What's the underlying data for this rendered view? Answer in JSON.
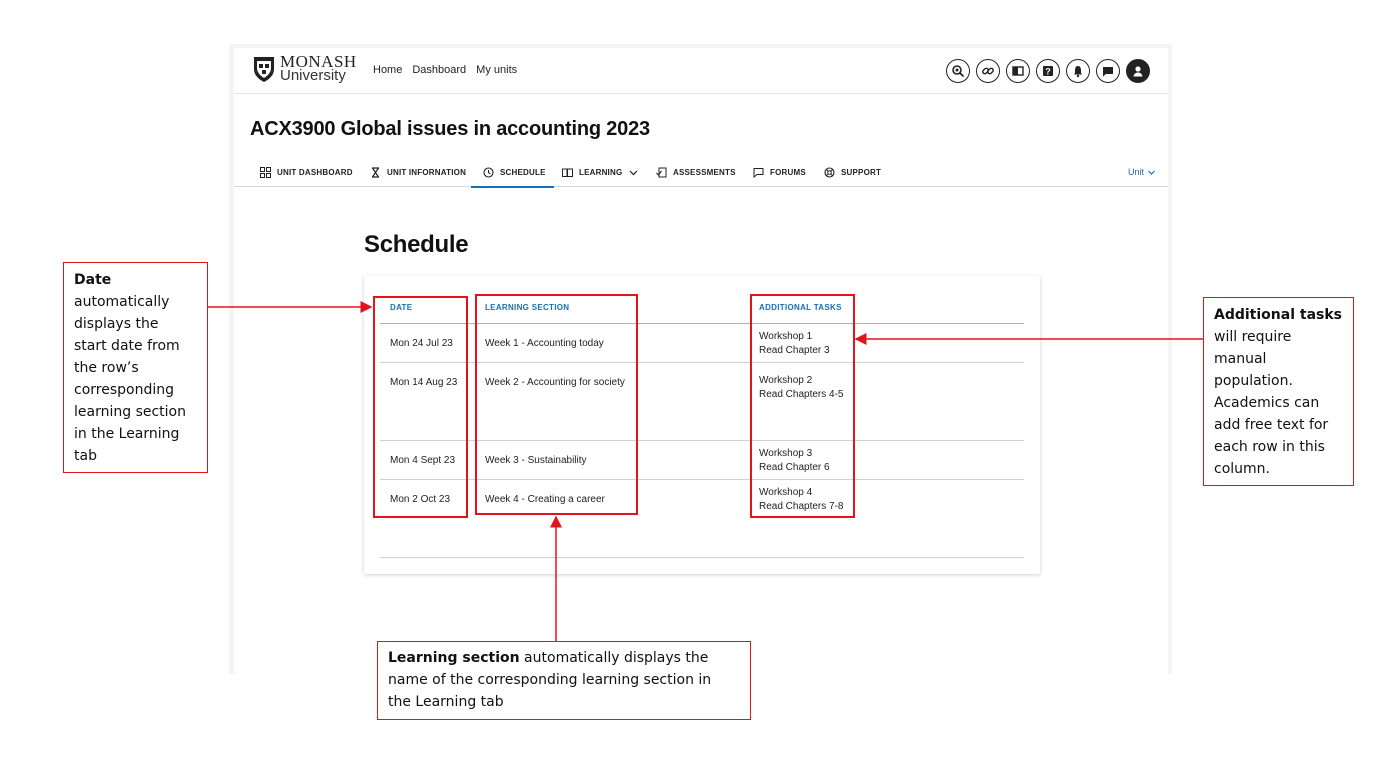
{
  "header": {
    "logo_line1": "MONASH",
    "logo_line2": "University",
    "nav": [
      "Home",
      "Dashboard",
      "My units"
    ],
    "icons": [
      "search-icon",
      "link-icon",
      "book-icon",
      "help-icon",
      "bell-icon",
      "chat-icon",
      "user-icon"
    ]
  },
  "unit": {
    "title": "ACX3900 Global issues in accounting 2023"
  },
  "tabs": [
    {
      "label": "UNIT DASHBOARD",
      "icon": "grid-icon"
    },
    {
      "label": "UNIT INFORNATION",
      "icon": "hourglass-icon"
    },
    {
      "label": "SCHEDULE",
      "icon": "clock-icon",
      "active": true
    },
    {
      "label": "LEARNING",
      "icon": "open-book-icon"
    },
    {
      "label": "ASSESSMENTS",
      "icon": "assessment-icon"
    },
    {
      "label": "FORUMS",
      "icon": "comment-icon"
    },
    {
      "label": "SUPPORT",
      "icon": "lifebuoy-icon"
    }
  ],
  "unit_switch": "Unit",
  "schedule": {
    "title": "Schedule",
    "columns": [
      "DATE",
      "LEARNING SECTION",
      "ADDITIONAL TASKS"
    ],
    "rows": [
      {
        "date": "Mon 24 Jul 23",
        "section": "Week 1 - Accounting today",
        "tasks": [
          "Workshop 1",
          "Read Chapter 3"
        ]
      },
      {
        "date": "Mon 14 Aug 23",
        "section": "Week 2 - Accounting for society",
        "tasks": [
          "Workshop 2",
          "Read Chapters 4-5"
        ]
      },
      {
        "date": "Mon 4 Sept 23",
        "section": "Week 3 - Sustainability",
        "tasks": [
          "Workshop 3",
          "Read Chapter 6"
        ]
      },
      {
        "date": "Mon 2 Oct 23",
        "section": "Week 4 - Creating a career",
        "tasks": [
          "Workshop 4",
          "Read Chapters 7-8"
        ]
      }
    ]
  },
  "annotations": {
    "date": {
      "title": "Date",
      "lines": [
        "automatically",
        "displays the",
        "start date from",
        "the row’s",
        "corresponding",
        "learning section",
        "in the Learning",
        "tab"
      ]
    },
    "tasks": {
      "title": "Additional tasks",
      "lines": [
        "will require",
        "manual",
        "population.",
        "Academics can",
        "add free text for",
        "each row in this",
        "column."
      ]
    },
    "learning": {
      "title": "Learning section",
      "rest": " automatically displays the",
      "lines": [
        "name of the corresponding learning section in",
        "the Learning tab"
      ]
    }
  },
  "colors": {
    "accent": "#1a6fb0",
    "annotation": "#e0151b"
  }
}
